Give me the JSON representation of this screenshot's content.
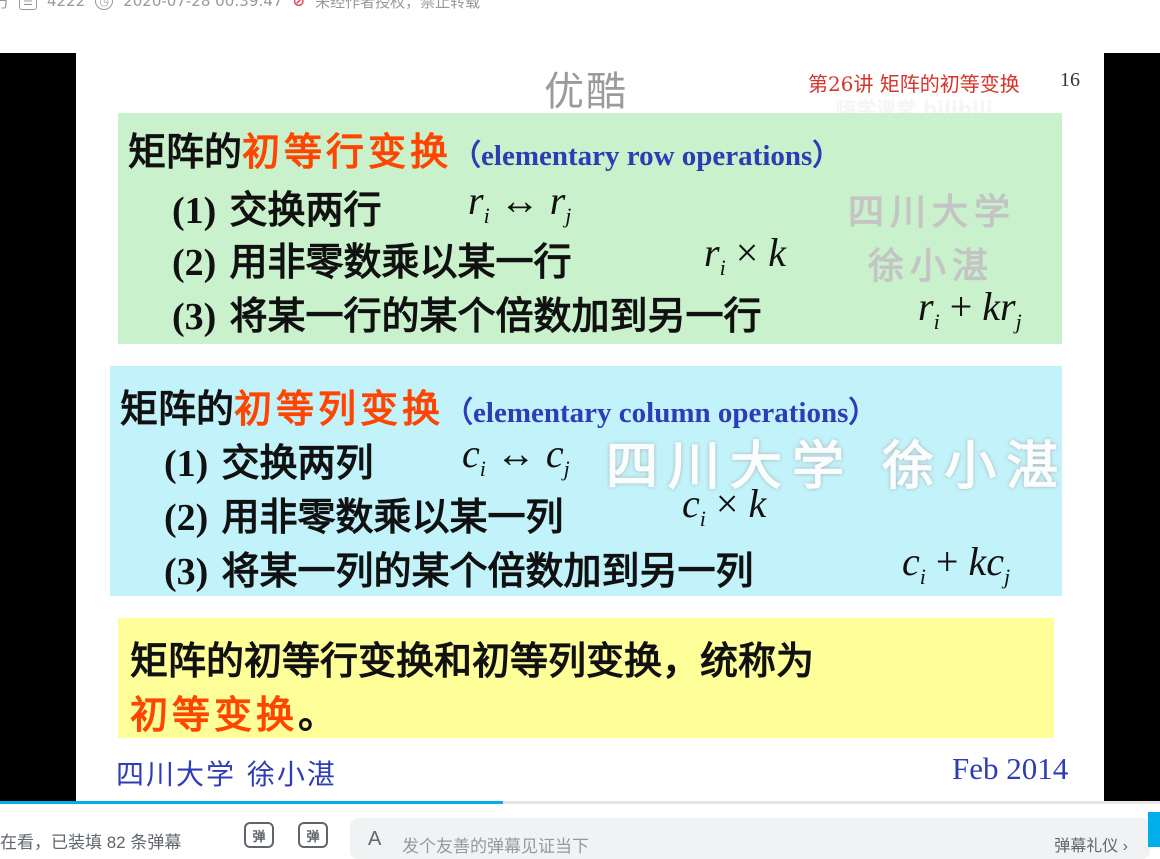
{
  "meta": {
    "view_count_icon": "play-count-icon",
    "danmaku_count": "4222",
    "danmaku_icon": "danmaku-count-icon",
    "clock_icon": "clock-icon",
    "publish_time": "2020-07-28 00:39:47",
    "no_repost_icon": "forbidden-icon",
    "no_repost_text": "未经作者授权，禁止转载"
  },
  "slide": {
    "youku_watermark": "优酷",
    "lecture_title": "第26讲  矩阵的初等变换",
    "page_number": "16",
    "overlay_watermark": "嗨学课堂 bilibili",
    "row_box": {
      "title_prefix": "矩阵的",
      "title_red": "初等行变换",
      "title_en": "（elementary row operations）",
      "items": [
        {
          "num": "(1)",
          "text": " 交换两行"
        },
        {
          "num": "(2)",
          "text": " 用非零数乘以某一行"
        },
        {
          "num": "(3)",
          "text": " 将某一行的某个倍数加到另一行"
        }
      ],
      "math": [
        {
          "a": "r",
          "a_sub": "i",
          "op": " ↔ ",
          "b": "r",
          "b_sub": "j"
        },
        {
          "a": "r",
          "a_sub": "i",
          "op": " × ",
          "b": "k",
          "b_sub": ""
        },
        {
          "a": "r",
          "a_sub": "i",
          "op": " + ",
          "b": "kr",
          "b_sub": "j"
        }
      ],
      "watermark_line1": "四川大学",
      "watermark_line2": "徐小湛"
    },
    "col_box": {
      "title_prefix": "矩阵的",
      "title_red": "初等列变换",
      "title_en": "（elementary column operations）",
      "items": [
        {
          "num": "(1)",
          "text": " 交换两列"
        },
        {
          "num": "(2)",
          "text": " 用非零数乘以某一列"
        },
        {
          "num": "(3)",
          "text": " 将某一列的某个倍数加到另一列"
        }
      ],
      "math": [
        {
          "a": "c",
          "a_sub": "i",
          "op": " ↔ ",
          "b": "c",
          "b_sub": "j"
        },
        {
          "a": "c",
          "a_sub": "i",
          "op": " × ",
          "b": "k",
          "b_sub": ""
        },
        {
          "a": "c",
          "a_sub": "i",
          "op": " + ",
          "b": "kc",
          "b_sub": "j"
        }
      ],
      "watermark": "四川大学 徐小湛"
    },
    "summary": {
      "line1": "矩阵的初等行变换和初等列变换，统称为",
      "line2_red": "初等变换",
      "line2_end": "。"
    },
    "footer_left": "四川大学  徐小湛",
    "footer_right": "Feb 2014"
  },
  "player": {
    "progress_fraction": 0.434
  },
  "danmaku_bar": {
    "status_text": "在看，已装填 82 条弹幕",
    "toggle_icon": "danmaku-toggle-icon",
    "settings_icon": "danmaku-settings-icon",
    "input_icon": "danmaku-style-icon",
    "input_icon_label": "A",
    "placeholder": "发个友善的弹幕见证当下",
    "etiquette": "弹幕礼仪 ›"
  },
  "colors": {
    "accent": "#00aeec",
    "red_heading": "#ff4500",
    "blue_text": "#2e3cb6",
    "green_box": "#c9f1cb",
    "cyan_box": "#c2f3fb",
    "yellow_box": "#ffff99"
  }
}
